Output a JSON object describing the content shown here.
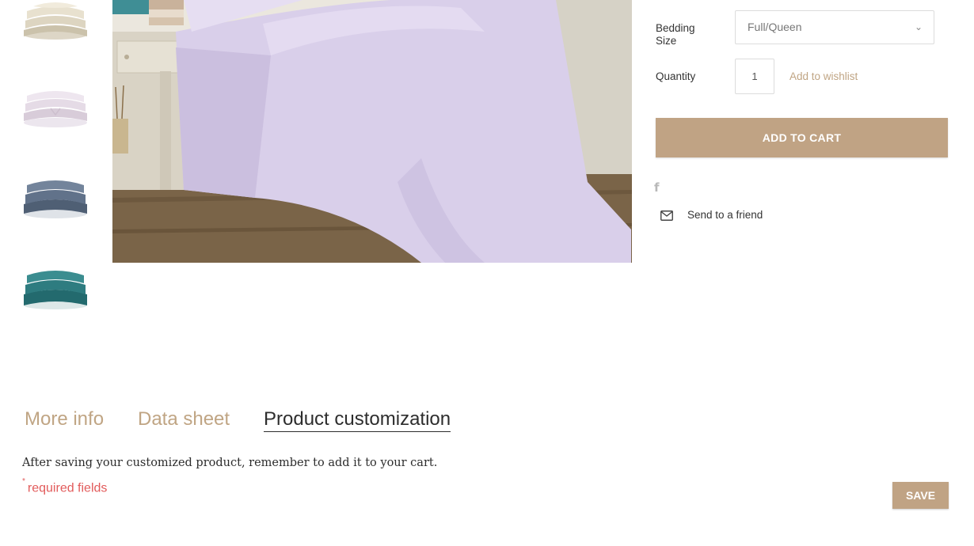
{
  "gallery": {
    "thumbnails": [
      {
        "color_name": "ivory",
        "color": "#d8d0bd"
      },
      {
        "color_name": "lilac",
        "color": "#ddd0e0"
      },
      {
        "color_name": "slate-blue",
        "color": "#5f7088"
      },
      {
        "color_name": "teal",
        "color": "#2f7a7e"
      }
    ],
    "main_image_color": "#d9cfea"
  },
  "product_options": {
    "size_label": "Bedding Size",
    "size_value": "Full/Queen",
    "quantity_label": "Quantity",
    "quantity_value": "1",
    "wishlist_link": "Add to wishlist",
    "add_to_cart_label": "ADD TO CART",
    "facebook_icon": "f",
    "send_to_friend_label": "Send to a friend"
  },
  "tabs": [
    {
      "label": "More info",
      "active": false
    },
    {
      "label": "Data sheet",
      "active": false
    },
    {
      "label": "Product customization",
      "active": true
    }
  ],
  "customization": {
    "note": "After saving your customized product, remember to add it to your cart.",
    "required_marker": "*",
    "required_text": "required fields",
    "save_label": "SAVE"
  },
  "colors": {
    "accent": "#c0a384",
    "link": "#c0a584",
    "required": "#e25b5b"
  }
}
